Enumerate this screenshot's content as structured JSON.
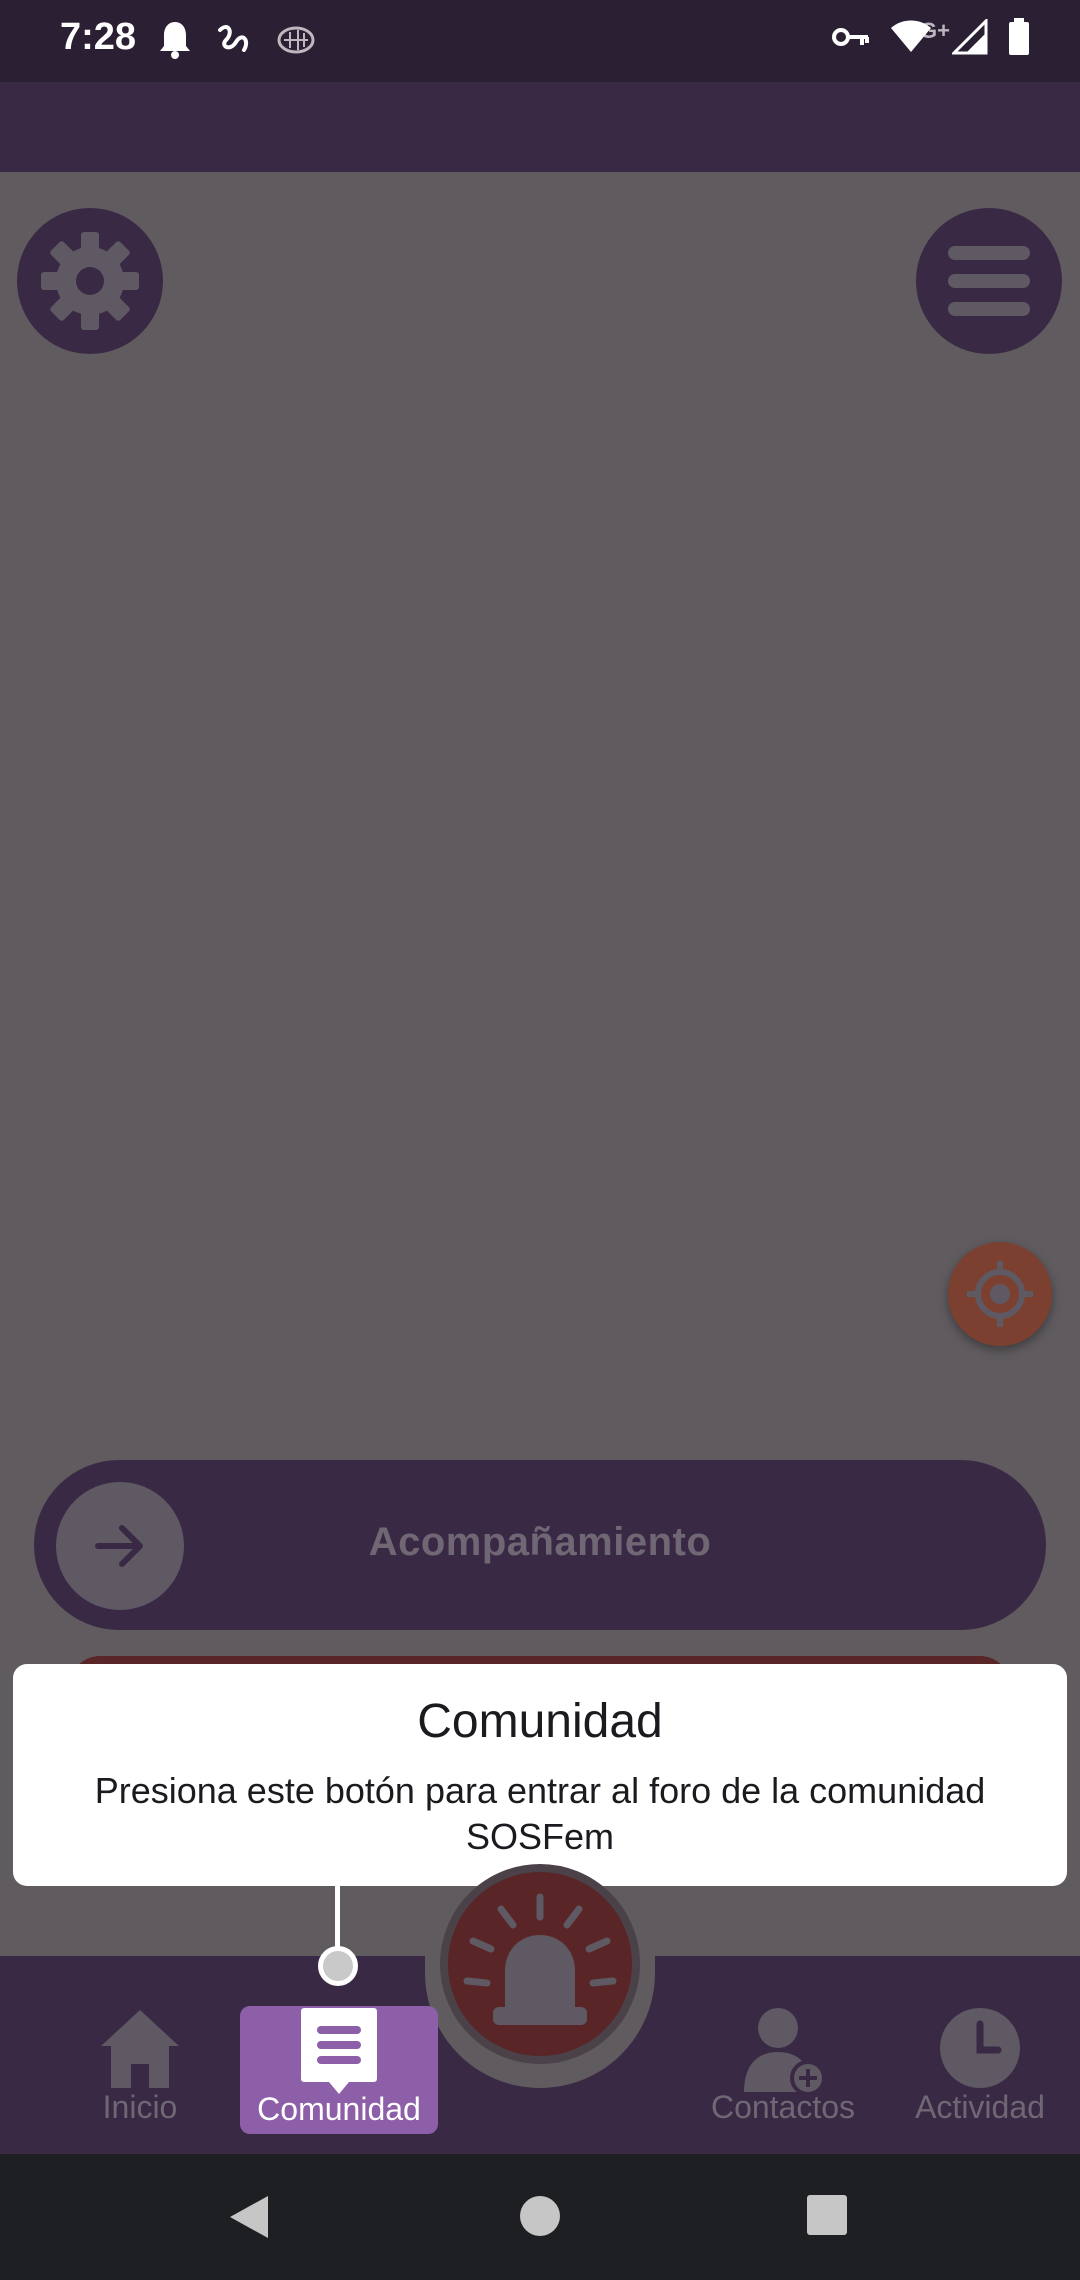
{
  "status_bar": {
    "time": "7:28",
    "network_label": "4G+",
    "icons_left": [
      "bell-icon",
      "squiggle-app-icon",
      "brain-app-icon"
    ],
    "icons_right": [
      "vpn-key-icon",
      "wifi-icon",
      "signal-icon",
      "battery-icon"
    ]
  },
  "map": {
    "settings_icon": "gear-icon",
    "menu_icon": "hamburger-menu-icon",
    "locate_icon": "crosshair-target-icon"
  },
  "accompaniment": {
    "label": "Acompañamiento",
    "icon": "arrow-right-icon"
  },
  "tooltip": {
    "title": "Comunidad",
    "text": "Presiona este botón para entrar al foro de la comunidad SOSFem"
  },
  "sos_button": {
    "icon": "alarm-siren-icon"
  },
  "bottom_nav": {
    "items": [
      {
        "label": "Inicio",
        "icon": "home-icon",
        "active": false
      },
      {
        "label": "Comunidad",
        "icon": "chat-bubble-icon",
        "active": true
      },
      {
        "label": "Contactos",
        "icon": "add-contact-icon",
        "active": false
      },
      {
        "label": "Actividad",
        "icon": "clock-icon",
        "active": false
      }
    ]
  },
  "colors": {
    "primary": "#3a2945",
    "active_tab": "#8e5fa9",
    "sos_red": "#5a2526",
    "overlay": "#5f5b5f"
  }
}
